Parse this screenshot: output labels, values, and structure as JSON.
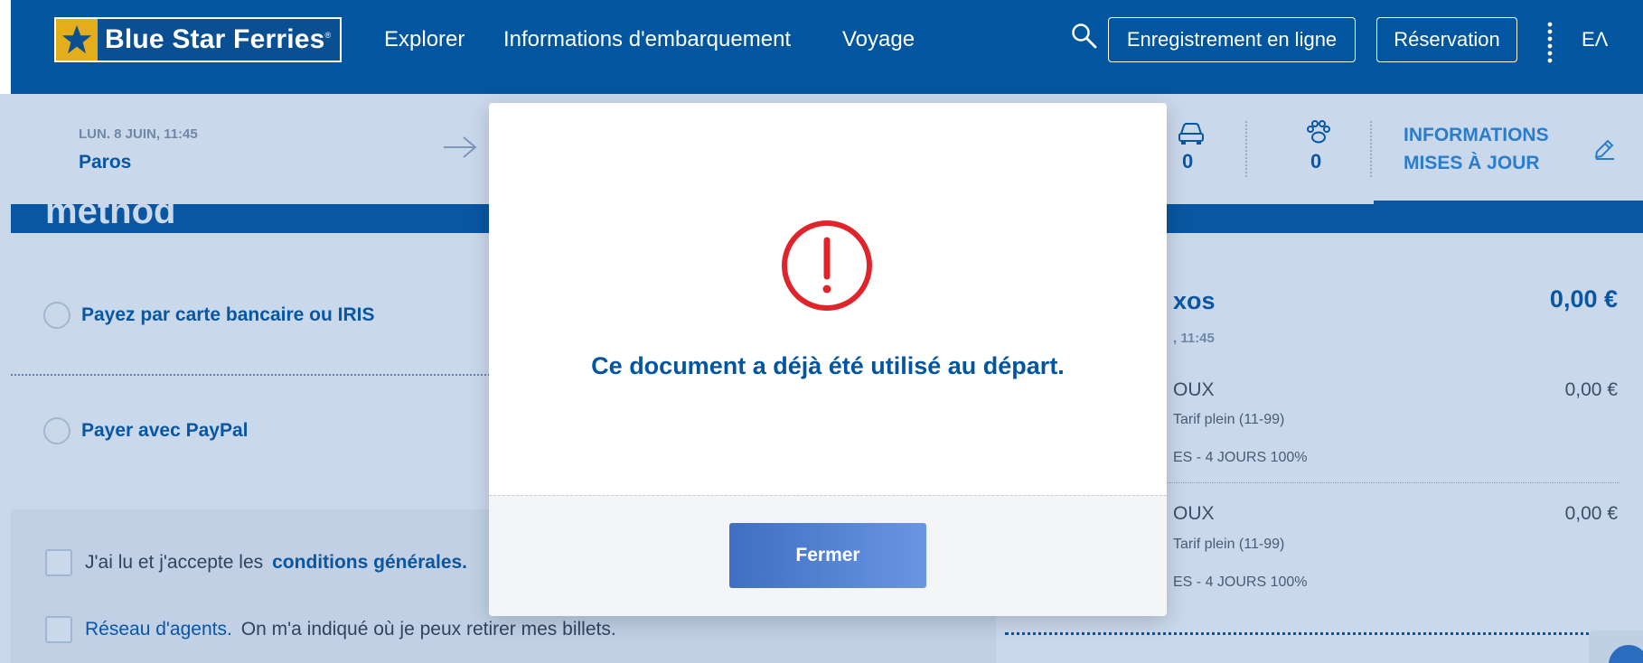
{
  "header": {
    "logo_text": "Blue Star Ferries",
    "logo_mark": "®",
    "nav": [
      "Explorer",
      "Informations d'embarquement",
      "Voyage"
    ],
    "checkin_label": "Enregistrement en ligne",
    "booking_label": "Réservation",
    "language": "ΕΛ",
    "colors": {
      "brand_blue": "#02559f",
      "logo_gold": "#e3ad1b"
    }
  },
  "trip": {
    "date_time": "LUN. 8 JUIN, 11:45",
    "from": "Paros",
    "vehicles_count": "0",
    "pets_count": "0",
    "info_line1": "INFORMATIONS",
    "info_line2": "MISES À JOUR"
  },
  "section": {
    "title_partial": "method"
  },
  "payment": {
    "options": [
      "Payez par carte bancaire ou IRIS",
      "Payer avec PayPal"
    ]
  },
  "agreements": {
    "terms_text": "J'ai lu et j'accepte les",
    "terms_link": "conditions générales.",
    "agent_link": "Réseau d'agents.",
    "agent_text": "On m'a indiqué où je peux retirer mes billets."
  },
  "summary": {
    "route_partial": "xos",
    "total": "0,00 €",
    "time_partial": ", 11:45",
    "rows": [
      {
        "name_partial": "OUX",
        "price": "0,00 €",
        "fare_partial": "Tarif plein (11-99)",
        "discount_partial": "ES - 4 JOURS 100%"
      },
      {
        "name_partial": "OUX",
        "price": "0,00 €",
        "fare_partial": "Tarif plein (11-99)",
        "discount_partial": "ES - 4 JOURS 100%"
      }
    ]
  },
  "modal": {
    "icon": "alert-circle-icon",
    "message": "Ce document a déjà été utilisé au départ.",
    "close_label": "Fermer",
    "colors": {
      "alert_red": "#e0242b",
      "message_blue": "#02559f"
    }
  }
}
